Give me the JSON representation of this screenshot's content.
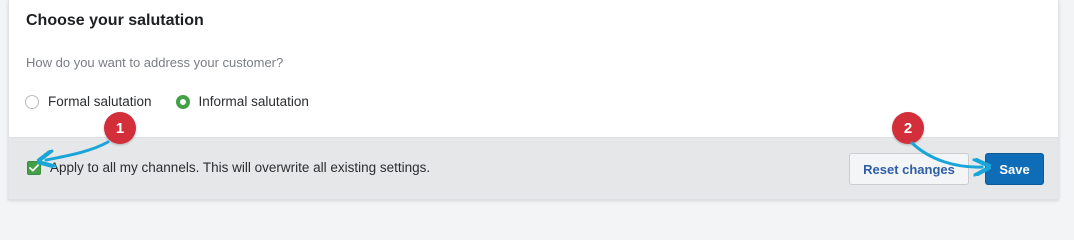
{
  "section": {
    "title": "Choose your salutation",
    "question": "How do you want to address your customer?"
  },
  "salutation_options": [
    {
      "label": "Formal salutation",
      "checked": false
    },
    {
      "label": "Informal salutation",
      "checked": true
    }
  ],
  "footer": {
    "apply_label": "Apply to all my channels. This will overwrite all existing settings.",
    "apply_checked": true,
    "reset_label": "Reset changes",
    "save_label": "Save"
  },
  "markers": {
    "one": "1",
    "two": "2"
  },
  "colors": {
    "accent_green": "#43a047",
    "primary_blue": "#0f6cb6",
    "marker_red": "#d32f3b",
    "arrow_cyan": "#1aa5d8"
  }
}
